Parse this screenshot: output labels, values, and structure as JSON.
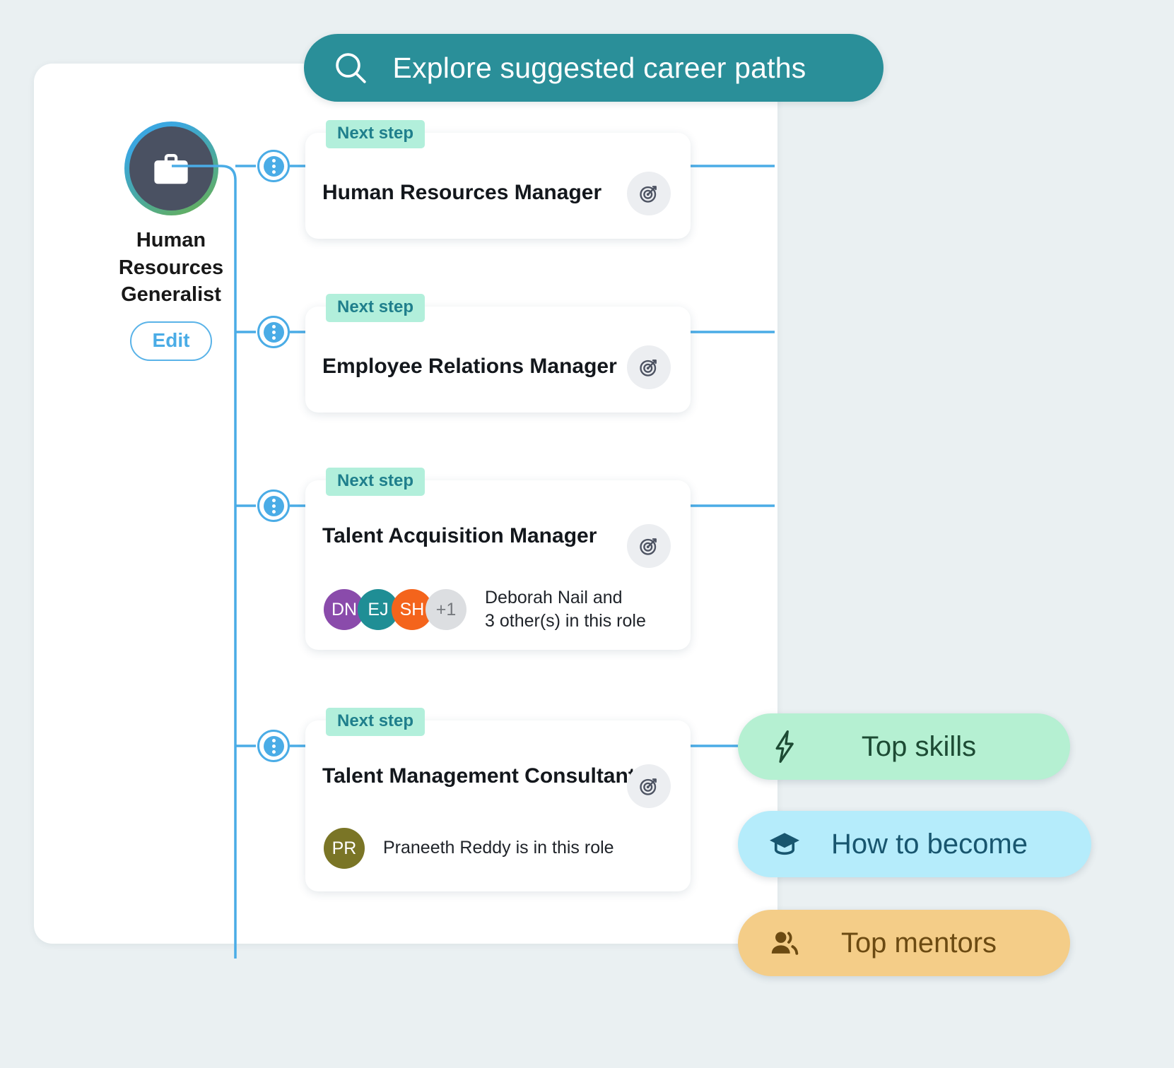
{
  "header": {
    "title": "Explore suggested career paths",
    "search_icon": "search-icon",
    "bg_color": "#2a8f99"
  },
  "root": {
    "icon": "briefcase-icon",
    "label": "Human\nResources\nGeneralist",
    "label_line1": "Human",
    "label_line2": "Resources",
    "label_line3": "Generalist",
    "edit_label": "Edit",
    "ring_colors": [
      "#3ba7e0",
      "#49a9a4",
      "#6cb04a"
    ],
    "inner_color": "#4a5162"
  },
  "cards": [
    {
      "badge": "Next step",
      "title": "Human Resources Manager",
      "goal_icon": "target-icon",
      "people": null
    },
    {
      "badge": "Next step",
      "title": "Employee Relations Manager",
      "goal_icon": "target-icon",
      "people": null
    },
    {
      "badge": "Next step",
      "title": "Talent Acquisition Manager",
      "goal_icon": "target-icon",
      "people": {
        "avatars": [
          {
            "initials": "DN",
            "color": "#8a4bab"
          },
          {
            "initials": "EJ",
            "color": "#1f8e95"
          },
          {
            "initials": "SH",
            "color": "#f4641c"
          },
          {
            "initials": "+1",
            "color": "#dcdee1",
            "text_color": "#76797e"
          }
        ],
        "text_line1": "Deborah Nail and",
        "text_line2": "3 other(s) in this role"
      }
    },
    {
      "badge": "Next step",
      "title": "Talent Management Consultant",
      "goal_icon": "target-icon",
      "people": {
        "avatars": [
          {
            "initials": "PR",
            "color": "#7a7526"
          }
        ],
        "text_line1": "Praneeth Reddy is in this role",
        "text_line2": ""
      }
    }
  ],
  "side_pills": [
    {
      "label": "Top skills",
      "icon": "lightning-bolt-icon",
      "bg": "#b5f0d2",
      "fg": "#1d4b34"
    },
    {
      "label": "How to become",
      "icon": "graduation-cap-icon",
      "bg": "#b5ecfb",
      "fg": "#18566f"
    },
    {
      "label": "Top mentors",
      "icon": "mentors-people-icon",
      "bg": "#f4cd88",
      "fg": "#6b4a12"
    }
  ]
}
